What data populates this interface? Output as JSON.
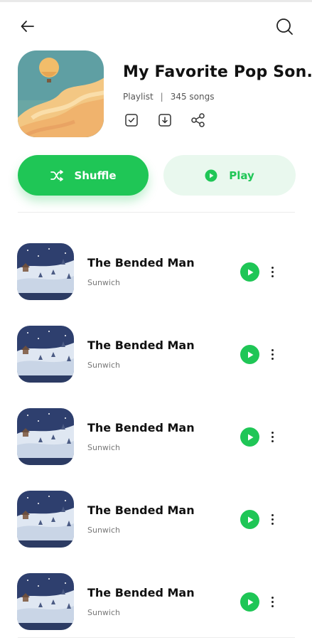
{
  "header": {
    "back_icon": "back-arrow-icon",
    "search_icon": "search-icon"
  },
  "playlist": {
    "title": "My Favorite Pop Son..",
    "type": "Playlist",
    "separator": "|",
    "count": "345 songs",
    "actions": [
      "check-square-icon",
      "download-icon",
      "share-icon"
    ]
  },
  "buttons": {
    "shuffle_label": "Shuffle",
    "play_label": "Play"
  },
  "colors": {
    "accent": "#1fc656",
    "accent_soft": "#e9f8ee"
  },
  "songs": [
    {
      "title": "The Bended Man",
      "artist": "Sunwich"
    },
    {
      "title": "The Bended Man",
      "artist": "Sunwich"
    },
    {
      "title": "The Bended Man",
      "artist": "Sunwich"
    },
    {
      "title": "The Bended Man",
      "artist": "Sunwich"
    },
    {
      "title": "The Bended Man",
      "artist": "Sunwich"
    }
  ]
}
